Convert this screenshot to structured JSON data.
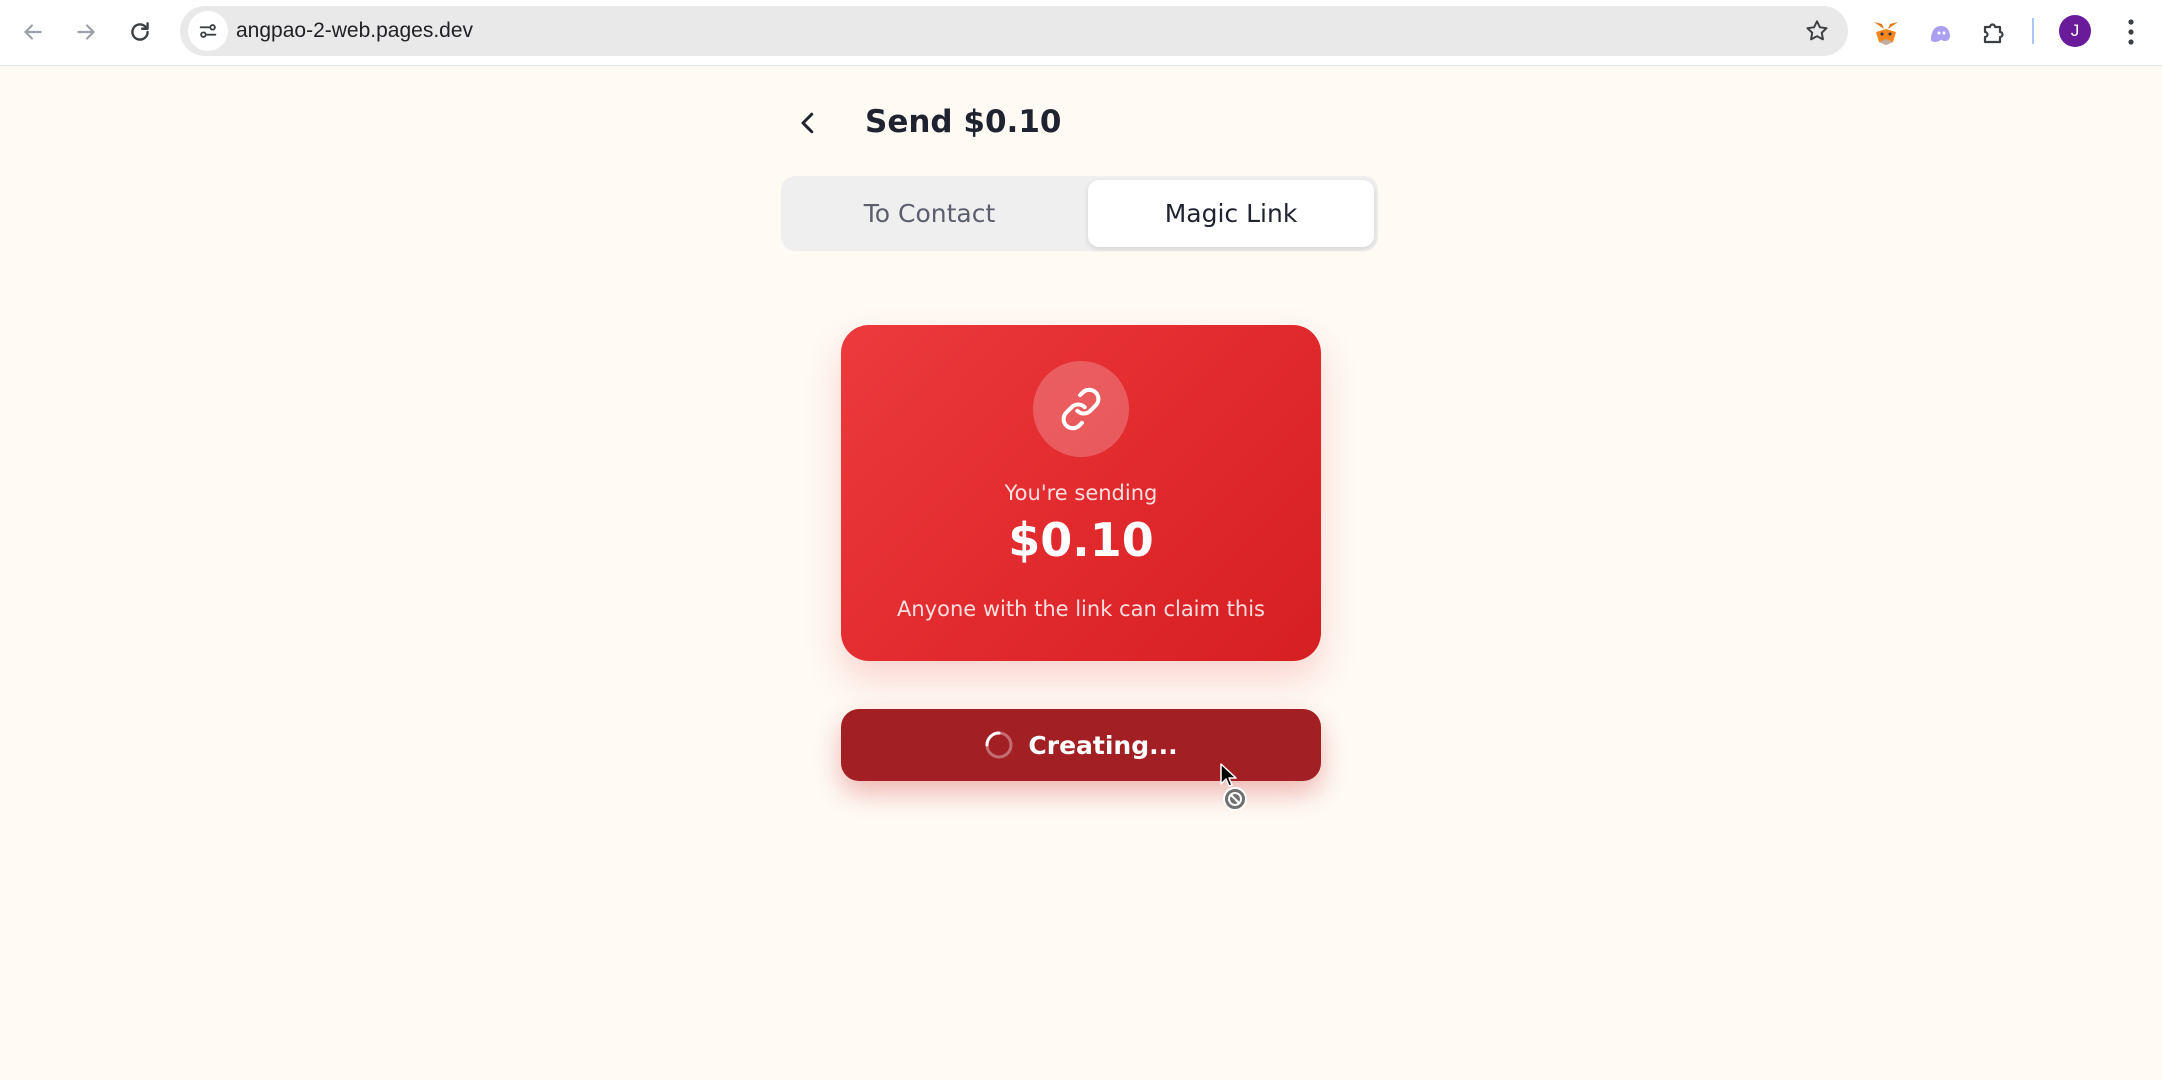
{
  "browser": {
    "url": "angpao-2-web.pages.dev",
    "avatar_initial": "J",
    "icons": [
      "back-arrow-icon",
      "forward-arrow-icon",
      "reload-icon",
      "site-info-icon",
      "bookmark-star-icon",
      "metamask-fox-icon",
      "ghost-extension-icon",
      "extensions-puzzle-icon",
      "more-menu-icon"
    ]
  },
  "header": {
    "title": "Send $0.10"
  },
  "tabs": [
    {
      "label": "To Contact",
      "active": false
    },
    {
      "label": "Magic Link",
      "active": true
    }
  ],
  "card": {
    "label": "You're sending",
    "amount": "$0.10",
    "note": "Anyone with the link can claim this",
    "icon": "link-icon"
  },
  "action": {
    "label": "Creating..."
  },
  "colors": {
    "page_bg": "#fffaf4",
    "card_red": "#e22b2e",
    "button_dark_red": "#a22024",
    "tab_bg": "#efeff0"
  }
}
